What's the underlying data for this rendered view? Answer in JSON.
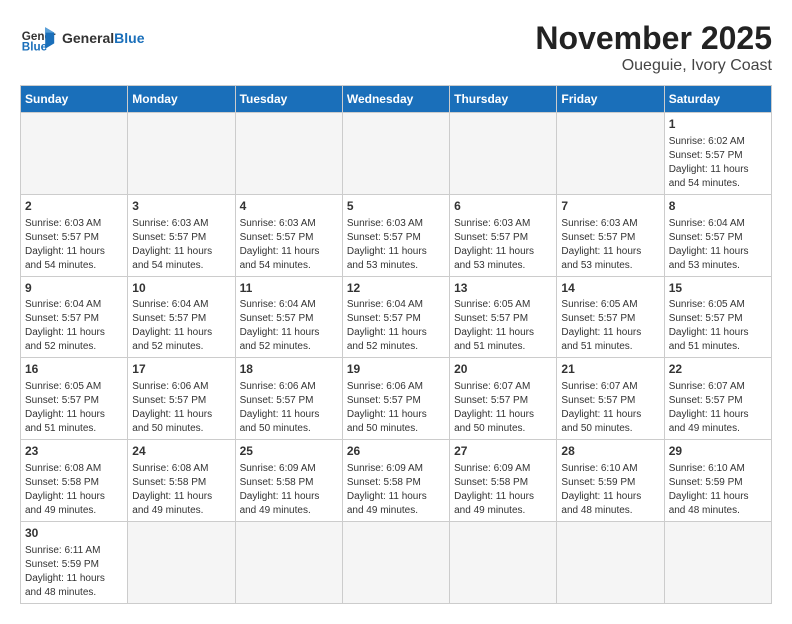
{
  "header": {
    "logo_general": "General",
    "logo_blue": "Blue",
    "title": "November 2025",
    "subtitle": "Oueguie, Ivory Coast"
  },
  "days_of_week": [
    "Sunday",
    "Monday",
    "Tuesday",
    "Wednesday",
    "Thursday",
    "Friday",
    "Saturday"
  ],
  "weeks": [
    [
      {
        "day": "",
        "info": ""
      },
      {
        "day": "",
        "info": ""
      },
      {
        "day": "",
        "info": ""
      },
      {
        "day": "",
        "info": ""
      },
      {
        "day": "",
        "info": ""
      },
      {
        "day": "",
        "info": ""
      },
      {
        "day": "1",
        "info": "Sunrise: 6:02 AM\nSunset: 5:57 PM\nDaylight: 11 hours\nand 54 minutes."
      }
    ],
    [
      {
        "day": "2",
        "info": "Sunrise: 6:03 AM\nSunset: 5:57 PM\nDaylight: 11 hours\nand 54 minutes."
      },
      {
        "day": "3",
        "info": "Sunrise: 6:03 AM\nSunset: 5:57 PM\nDaylight: 11 hours\nand 54 minutes."
      },
      {
        "day": "4",
        "info": "Sunrise: 6:03 AM\nSunset: 5:57 PM\nDaylight: 11 hours\nand 54 minutes."
      },
      {
        "day": "5",
        "info": "Sunrise: 6:03 AM\nSunset: 5:57 PM\nDaylight: 11 hours\nand 53 minutes."
      },
      {
        "day": "6",
        "info": "Sunrise: 6:03 AM\nSunset: 5:57 PM\nDaylight: 11 hours\nand 53 minutes."
      },
      {
        "day": "7",
        "info": "Sunrise: 6:03 AM\nSunset: 5:57 PM\nDaylight: 11 hours\nand 53 minutes."
      },
      {
        "day": "8",
        "info": "Sunrise: 6:04 AM\nSunset: 5:57 PM\nDaylight: 11 hours\nand 53 minutes."
      }
    ],
    [
      {
        "day": "9",
        "info": "Sunrise: 6:04 AM\nSunset: 5:57 PM\nDaylight: 11 hours\nand 52 minutes."
      },
      {
        "day": "10",
        "info": "Sunrise: 6:04 AM\nSunset: 5:57 PM\nDaylight: 11 hours\nand 52 minutes."
      },
      {
        "day": "11",
        "info": "Sunrise: 6:04 AM\nSunset: 5:57 PM\nDaylight: 11 hours\nand 52 minutes."
      },
      {
        "day": "12",
        "info": "Sunrise: 6:04 AM\nSunset: 5:57 PM\nDaylight: 11 hours\nand 52 minutes."
      },
      {
        "day": "13",
        "info": "Sunrise: 6:05 AM\nSunset: 5:57 PM\nDaylight: 11 hours\nand 51 minutes."
      },
      {
        "day": "14",
        "info": "Sunrise: 6:05 AM\nSunset: 5:57 PM\nDaylight: 11 hours\nand 51 minutes."
      },
      {
        "day": "15",
        "info": "Sunrise: 6:05 AM\nSunset: 5:57 PM\nDaylight: 11 hours\nand 51 minutes."
      }
    ],
    [
      {
        "day": "16",
        "info": "Sunrise: 6:05 AM\nSunset: 5:57 PM\nDaylight: 11 hours\nand 51 minutes."
      },
      {
        "day": "17",
        "info": "Sunrise: 6:06 AM\nSunset: 5:57 PM\nDaylight: 11 hours\nand 50 minutes."
      },
      {
        "day": "18",
        "info": "Sunrise: 6:06 AM\nSunset: 5:57 PM\nDaylight: 11 hours\nand 50 minutes."
      },
      {
        "day": "19",
        "info": "Sunrise: 6:06 AM\nSunset: 5:57 PM\nDaylight: 11 hours\nand 50 minutes."
      },
      {
        "day": "20",
        "info": "Sunrise: 6:07 AM\nSunset: 5:57 PM\nDaylight: 11 hours\nand 50 minutes."
      },
      {
        "day": "21",
        "info": "Sunrise: 6:07 AM\nSunset: 5:57 PM\nDaylight: 11 hours\nand 50 minutes."
      },
      {
        "day": "22",
        "info": "Sunrise: 6:07 AM\nSunset: 5:57 PM\nDaylight: 11 hours\nand 49 minutes."
      }
    ],
    [
      {
        "day": "23",
        "info": "Sunrise: 6:08 AM\nSunset: 5:58 PM\nDaylight: 11 hours\nand 49 minutes."
      },
      {
        "day": "24",
        "info": "Sunrise: 6:08 AM\nSunset: 5:58 PM\nDaylight: 11 hours\nand 49 minutes."
      },
      {
        "day": "25",
        "info": "Sunrise: 6:09 AM\nSunset: 5:58 PM\nDaylight: 11 hours\nand 49 minutes."
      },
      {
        "day": "26",
        "info": "Sunrise: 6:09 AM\nSunset: 5:58 PM\nDaylight: 11 hours\nand 49 minutes."
      },
      {
        "day": "27",
        "info": "Sunrise: 6:09 AM\nSunset: 5:58 PM\nDaylight: 11 hours\nand 49 minutes."
      },
      {
        "day": "28",
        "info": "Sunrise: 6:10 AM\nSunset: 5:59 PM\nDaylight: 11 hours\nand 48 minutes."
      },
      {
        "day": "29",
        "info": "Sunrise: 6:10 AM\nSunset: 5:59 PM\nDaylight: 11 hours\nand 48 minutes."
      }
    ],
    [
      {
        "day": "30",
        "info": "Sunrise: 6:11 AM\nSunset: 5:59 PM\nDaylight: 11 hours\nand 48 minutes."
      },
      {
        "day": "",
        "info": ""
      },
      {
        "day": "",
        "info": ""
      },
      {
        "day": "",
        "info": ""
      },
      {
        "day": "",
        "info": ""
      },
      {
        "day": "",
        "info": ""
      },
      {
        "day": "",
        "info": ""
      }
    ]
  ]
}
